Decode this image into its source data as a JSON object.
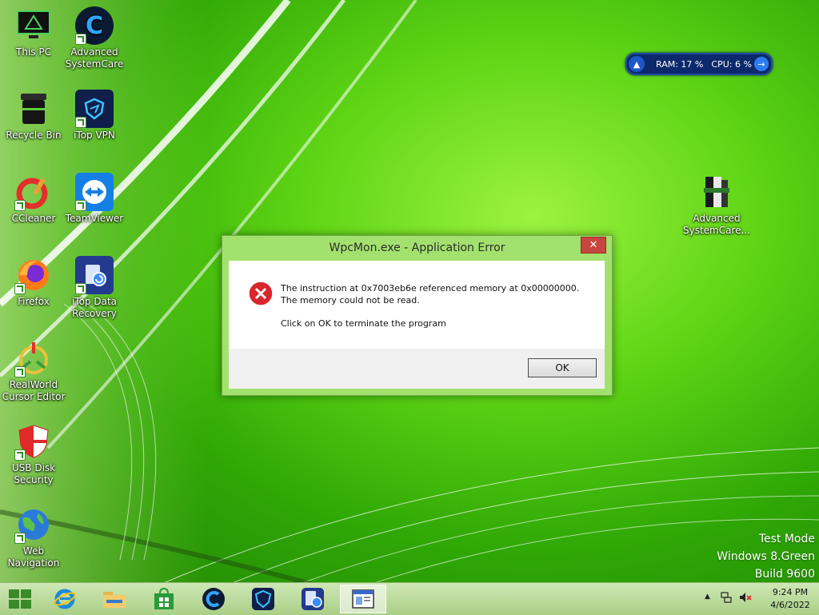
{
  "desktop": {
    "left_icons": [
      {
        "label": "This PC",
        "icon": "monitor-icon"
      },
      {
        "label": "Advanced SystemCare",
        "icon": "advanced-systemcare-icon"
      },
      {
        "label": "Recycle Bin",
        "icon": "recycle-bin-icon"
      },
      {
        "label": "iTop VPN",
        "icon": "itop-vpn-icon"
      },
      {
        "label": "CCleaner",
        "icon": "ccleaner-icon"
      },
      {
        "label": "TeamViewer",
        "icon": "teamviewer-icon"
      },
      {
        "label": "Firefox",
        "icon": "firefox-icon"
      },
      {
        "label": "iTop Data Recovery",
        "icon": "itop-data-recovery-icon"
      },
      {
        "label": "RealWorld Cursor Editor",
        "icon": "realworld-cursor-editor-icon"
      },
      {
        "label": "USB Disk Security",
        "icon": "usb-disk-security-icon"
      },
      {
        "label": "Web Navigation",
        "icon": "globe-icon"
      }
    ],
    "right_icon": {
      "label": "Advanced SystemCare...",
      "icon": "winrar-archive-icon"
    }
  },
  "widget": {
    "ram": "RAM: 17 %",
    "cpu": "CPU: 6 %",
    "accent": "#0c2a6b"
  },
  "dialog": {
    "title": "WpcMon.exe - Application Error",
    "close_label": "✕",
    "message": "The instruction at 0x7003eb6e referenced memory at 0x00000000. The memory could not be read.",
    "prompt": "Click on OK to terminate the program",
    "ok_label": "OK",
    "icon": "error-icon"
  },
  "watermark": {
    "line1": "Test Mode",
    "line2": "Windows 8.Green",
    "line3": "Build 9600"
  },
  "taskbar": {
    "items": [
      {
        "name": "start-button",
        "icon": "windows-logo-icon"
      },
      {
        "name": "internet-explorer",
        "icon": "internet-explorer-icon"
      },
      {
        "name": "file-explorer",
        "icon": "folder-icon"
      },
      {
        "name": "store",
        "icon": "store-icon"
      },
      {
        "name": "advanced-systemcare",
        "icon": "advanced-systemcare-icon"
      },
      {
        "name": "itop-vpn",
        "icon": "itop-vpn-icon"
      },
      {
        "name": "itop-data-recovery",
        "icon": "itop-data-recovery-icon"
      },
      {
        "name": "wpcmon-window",
        "icon": "window-icon"
      }
    ],
    "tray": {
      "chevron": "▲",
      "time": "9:24 PM",
      "date": "4/6/2022"
    }
  }
}
